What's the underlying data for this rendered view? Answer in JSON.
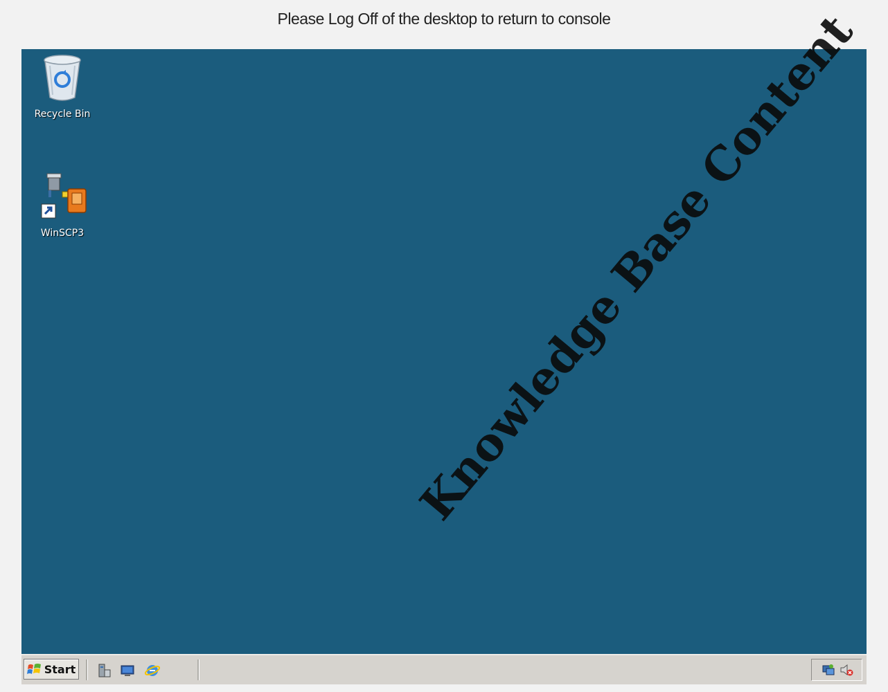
{
  "banner": {
    "text": "Please Log Off of the desktop to return to console"
  },
  "desktop": {
    "background_color": "#1b5c7d",
    "icons": [
      {
        "label": "Recycle Bin",
        "icon": "recycle-bin-icon"
      },
      {
        "label": "WinSCP3",
        "icon": "winscp-icon"
      }
    ]
  },
  "watermark": {
    "text": "Knowledge Base Content"
  },
  "taskbar": {
    "start_label": "Start",
    "quick_launch": [
      "server-manager-icon",
      "show-desktop-icon",
      "internet-explorer-icon"
    ],
    "tray": [
      "network-icon",
      "volume-muted-icon"
    ]
  }
}
